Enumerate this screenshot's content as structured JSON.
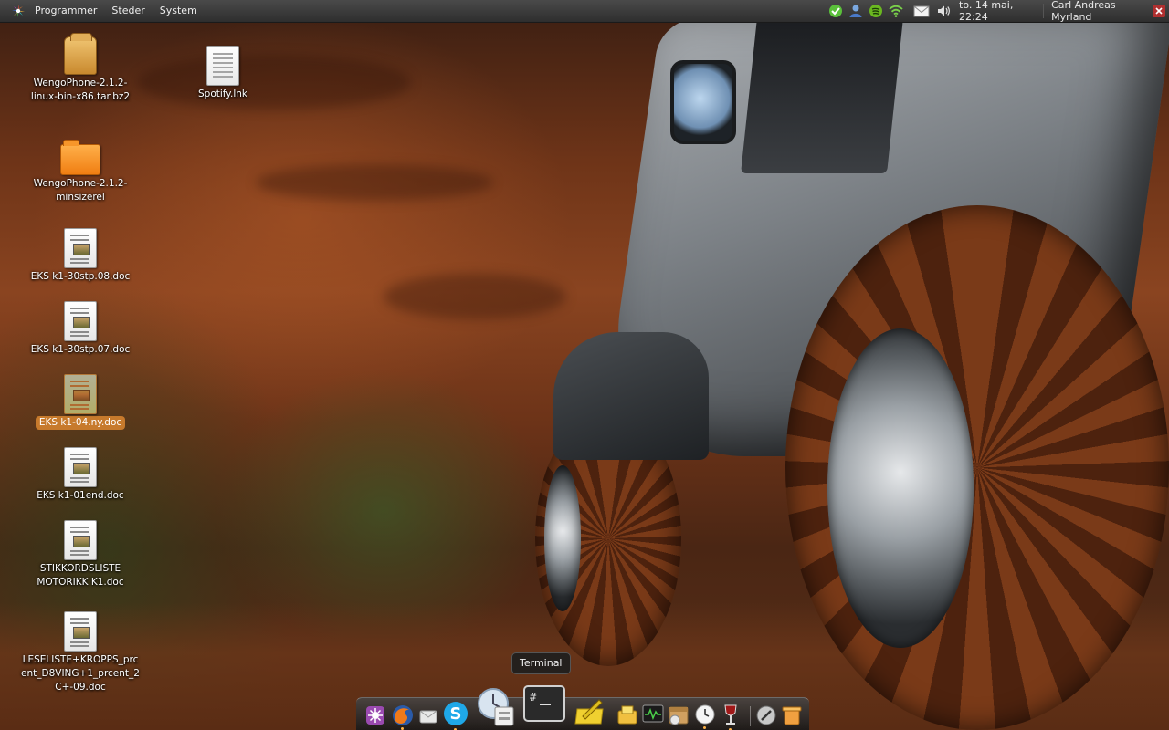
{
  "top_panel": {
    "menus": [
      "Programmer",
      "Steder",
      "System"
    ],
    "clock": "to. 14 mai, 22:24",
    "user": "Carl Andreas Myrland",
    "tray_icons": [
      "messenger-icon",
      "contacts-icon",
      "spotify-tray-icon",
      "wifi-icon",
      "mail-icon",
      "volume-icon"
    ]
  },
  "desktop": {
    "icons": [
      {
        "label": "WengoPhone-2.1.2-linux-bin-x86.tar.bz2",
        "kind": "archive-icon"
      },
      {
        "label": "Spotify.lnk",
        "kind": "text-file-icon"
      },
      {
        "label": "WengoPhone-2.1.2-minsizerel",
        "kind": "folder-icon"
      },
      {
        "label": "EKS k1-30stp.08.doc",
        "kind": "document-icon"
      },
      {
        "label": "EKS k1-30stp.07.doc",
        "kind": "document-icon"
      },
      {
        "label": "EKS k1-04.ny.doc",
        "kind": "document-icon",
        "selected": true
      },
      {
        "label": "EKS k1-01end.doc",
        "kind": "document-icon"
      },
      {
        "label": "STIKKORDSLISTE MOTORIKK K1.doc",
        "kind": "document-icon"
      },
      {
        "label": "LESELISTE+KROPPS_prcent_D8VING+1_prcent_2C+-09.doc",
        "kind": "document-icon"
      }
    ]
  },
  "tooltip": {
    "text": "Terminal"
  },
  "dock": {
    "items": [
      "app-launcher-icon",
      "firefox-icon",
      "mail-client-icon",
      "skype-icon",
      "mail-reader-icon",
      "terminal-icon",
      "notes-icon",
      "files-icon",
      "system-monitor-icon",
      "archive-manager-icon",
      "clock-icon",
      "wine-icon",
      "gimp-icon",
      "trash-icon"
    ]
  },
  "colors": {
    "panel_bg": "#3a3a3a",
    "selected_label": "#c77a2c",
    "dock_indicator": "#ffb347"
  }
}
